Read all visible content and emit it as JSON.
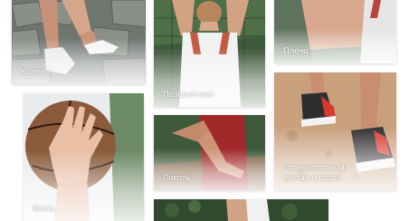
{
  "cards": {
    "knee": {
      "label": "Колено",
      "icon": "knee-photo"
    },
    "spine": {
      "label": "Позвоночник",
      "icon": "spine-photo"
    },
    "shoulder": {
      "label": "Плечо",
      "icon": "shoulder-photo"
    },
    "wrist": {
      "label": "Кисть",
      "icon": "wrist-photo"
    },
    "elbow": {
      "label": "Локоть",
      "icon": "elbow-photo"
    },
    "ankle": {
      "label_line1": "Голеностопный",
      "label_line2": "сустав и стопа",
      "icon": "ankle-photo"
    }
  },
  "colors": {
    "overlay": "#ffffff",
    "label_text": "#ffffff"
  }
}
